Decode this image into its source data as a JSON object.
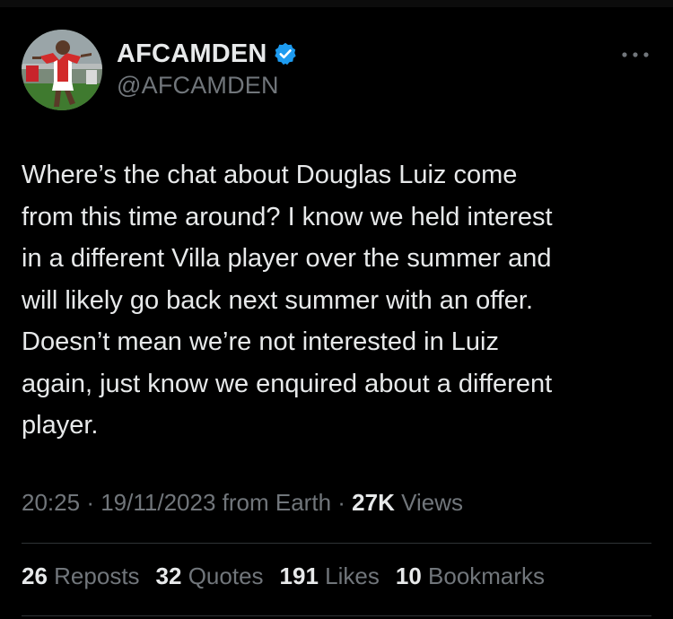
{
  "account": {
    "display_name": "AFCAMDEN",
    "handle": "@AFCAMDEN",
    "verified": true,
    "verified_color": "#1d9bf0",
    "avatar_icon": "footballer-avatar"
  },
  "more_icon": "more-options-icon",
  "tweet": {
    "text": "Where’s the chat about Douglas Luiz come\nfrom this time around? I know we held interest\nin a different Villa player over the summer and\nwill likely go back next summer with an offer.\nDoesn’t mean we’re not interested in Luiz\nagain, just know we enquired about a different\nplayer."
  },
  "meta": {
    "time": "20:25",
    "separator": "·",
    "date": "19/11/2023",
    "source": "from Earth",
    "views_count": "27K",
    "views_label": "Views"
  },
  "stats": [
    {
      "count": "26",
      "label": "Reposts"
    },
    {
      "count": "32",
      "label": "Quotes"
    },
    {
      "count": "191",
      "label": "Likes"
    },
    {
      "count": "10",
      "label": "Bookmarks"
    }
  ],
  "colors": {
    "background": "#000000",
    "primary_text": "#e7e9ea",
    "secondary_text": "#71767b",
    "divider": "#2f3336"
  }
}
